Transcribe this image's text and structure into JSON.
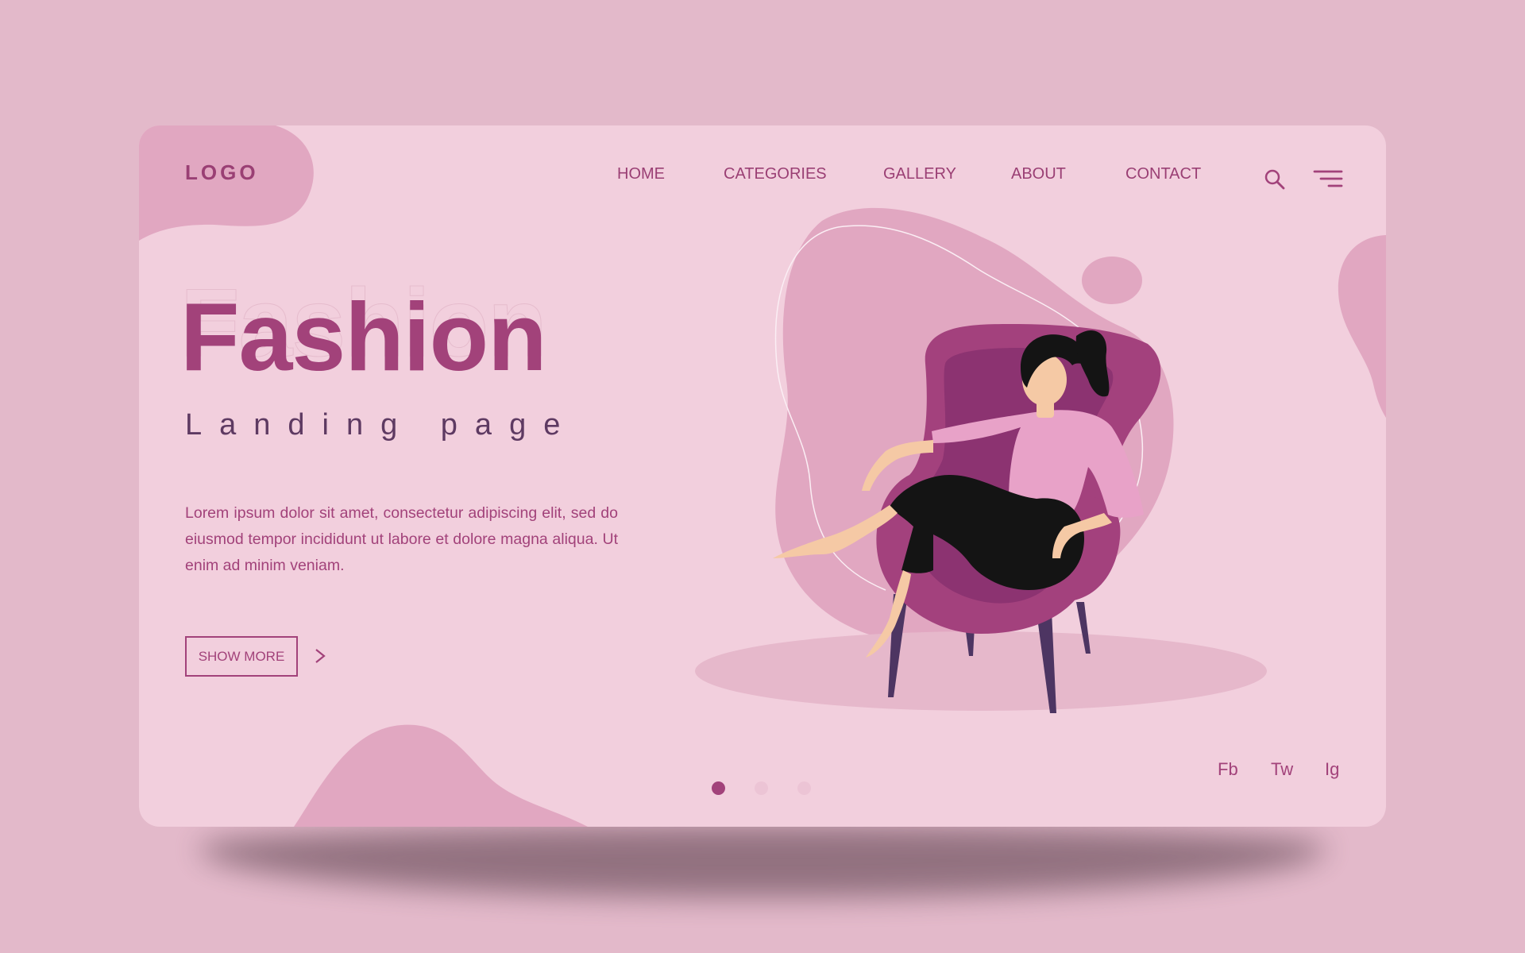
{
  "header": {
    "logo": "LOGO",
    "nav": [
      {
        "label": "HOME"
      },
      {
        "label": "CATEGORIES"
      },
      {
        "label": "GALLERY"
      },
      {
        "label": "ABOUT"
      },
      {
        "label": "CONTACT"
      }
    ],
    "search_icon": "search-icon",
    "menu_icon": "hamburger-menu-icon"
  },
  "hero": {
    "title": "Fashion",
    "subtitle": "Landing page",
    "body": "Lorem ipsum dolor sit amet, consectetur adipiscing elit, sed do eiusmod tempor incididunt ut labore et dolore magna aliqua. Ut enim ad minim veniam.",
    "cta_label": "SHOW MORE",
    "cta_icon": "chevron-right-icon"
  },
  "pagination": {
    "count": 3,
    "active_index": 0
  },
  "social": [
    {
      "label": "Fb"
    },
    {
      "label": "Tw"
    },
    {
      "label": "Ig"
    }
  ],
  "colors": {
    "page_bg": "#e3b9ca",
    "card_bg": "#f2cfdd",
    "accent": "#a2427a",
    "blob": "#e1a7c1",
    "chair": "#a3417d",
    "text_dark": "#5e3a62"
  }
}
